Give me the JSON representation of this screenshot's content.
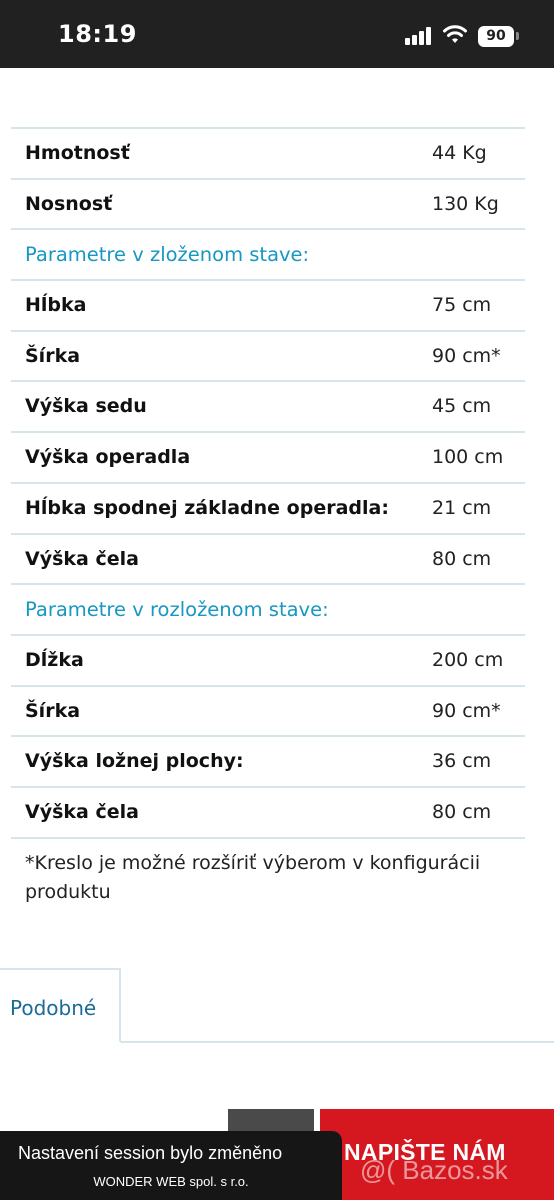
{
  "status_bar": {
    "time": "18:19",
    "battery": "90"
  },
  "spec_rows": [
    {
      "label": "Hmotnosť",
      "value": "44 Kg"
    },
    {
      "label": "Nosnosť",
      "value": "130 Kg"
    },
    {
      "label": "Parametre v zloženom stave:",
      "value": ""
    },
    {
      "label": "Hĺbka",
      "value": "75 cm"
    },
    {
      "label": "Šírka",
      "value": "90 cm*"
    },
    {
      "label": "Výška sedu",
      "value": "45 cm"
    },
    {
      "label": "Výška operadla",
      "value": "100 cm"
    },
    {
      "label": "Hĺbka spodnej základne operadla:",
      "value": "21 cm"
    },
    {
      "label": "Výška čela",
      "value": "80 cm"
    },
    {
      "label": "Parametre v rozloženom stave:",
      "value": ""
    },
    {
      "label": "Dĺžka",
      "value": "200 cm"
    },
    {
      "label": "Šírka",
      "value": "90 cm*"
    },
    {
      "label": "Výška ložnej plochy:",
      "value": "36 cm"
    },
    {
      "label": "Výška čela",
      "value": "80 cm"
    }
  ],
  "footnote": "*Kreslo je možné rozšíriť výberom v konfigurácii produktu",
  "tabs": {
    "similar": "Podobné"
  },
  "cta": {
    "label": "NAPIŠTE NÁM"
  },
  "watermark": "@( Bazos.sk",
  "toast": {
    "title": "Nastavení session bylo změněno",
    "subtitle": "WONDER WEB spol. s r.o."
  },
  "colors": {
    "section_header": "#1797c1",
    "row_border": "#d6e4ec",
    "cta_background": "#d51820"
  }
}
